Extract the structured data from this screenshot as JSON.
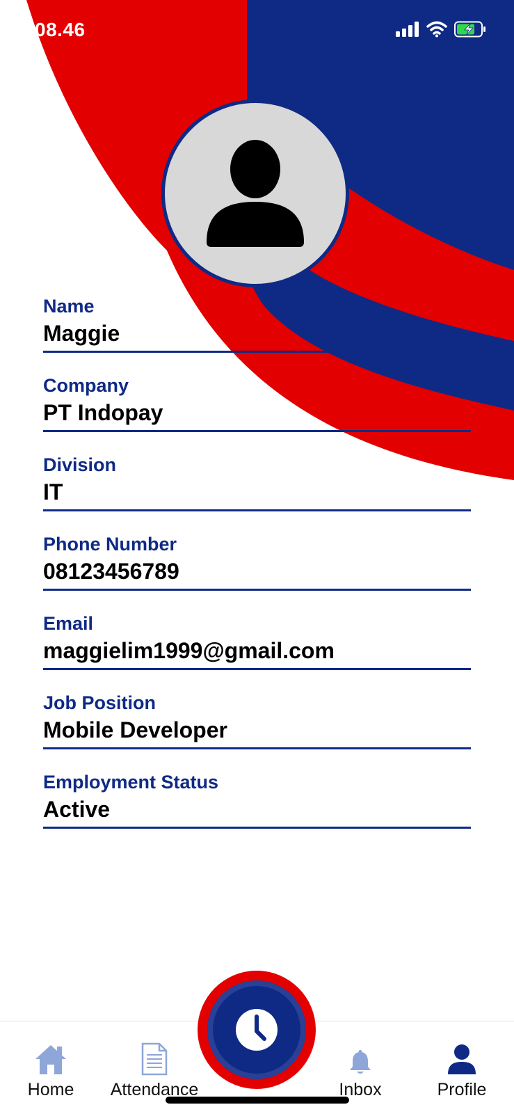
{
  "colors": {
    "brand_blue": "#0f2a85",
    "brand_red": "#e30000",
    "avatar_bg": "#d8d8d8",
    "nav_inactive": "#8ea6d8"
  },
  "status_bar": {
    "time": "08.46",
    "icons": [
      "cellular-signal-icon",
      "wifi-icon",
      "battery-charging-icon"
    ]
  },
  "profile": {
    "avatar_icon": "person-icon",
    "fields": [
      {
        "label": "Name",
        "value": "Maggie"
      },
      {
        "label": "Company",
        "value": "PT Indopay"
      },
      {
        "label": "Division",
        "value": "IT"
      },
      {
        "label": "Phone Number",
        "value": "08123456789"
      },
      {
        "label": "Email",
        "value": "maggielim1999@gmail.com"
      },
      {
        "label": "Job Position",
        "value": "Mobile Developer"
      },
      {
        "label": "Employment Status",
        "value": "Active"
      }
    ]
  },
  "tab_bar": {
    "items": [
      {
        "label": "Home",
        "icon": "home-icon",
        "active": false
      },
      {
        "label": "Attendance",
        "icon": "document-icon",
        "active": false
      },
      {
        "label": "Inbox",
        "icon": "bell-icon",
        "active": false
      },
      {
        "label": "Profile",
        "icon": "person-icon",
        "active": true
      }
    ],
    "center_button_icon": "clock-icon"
  }
}
